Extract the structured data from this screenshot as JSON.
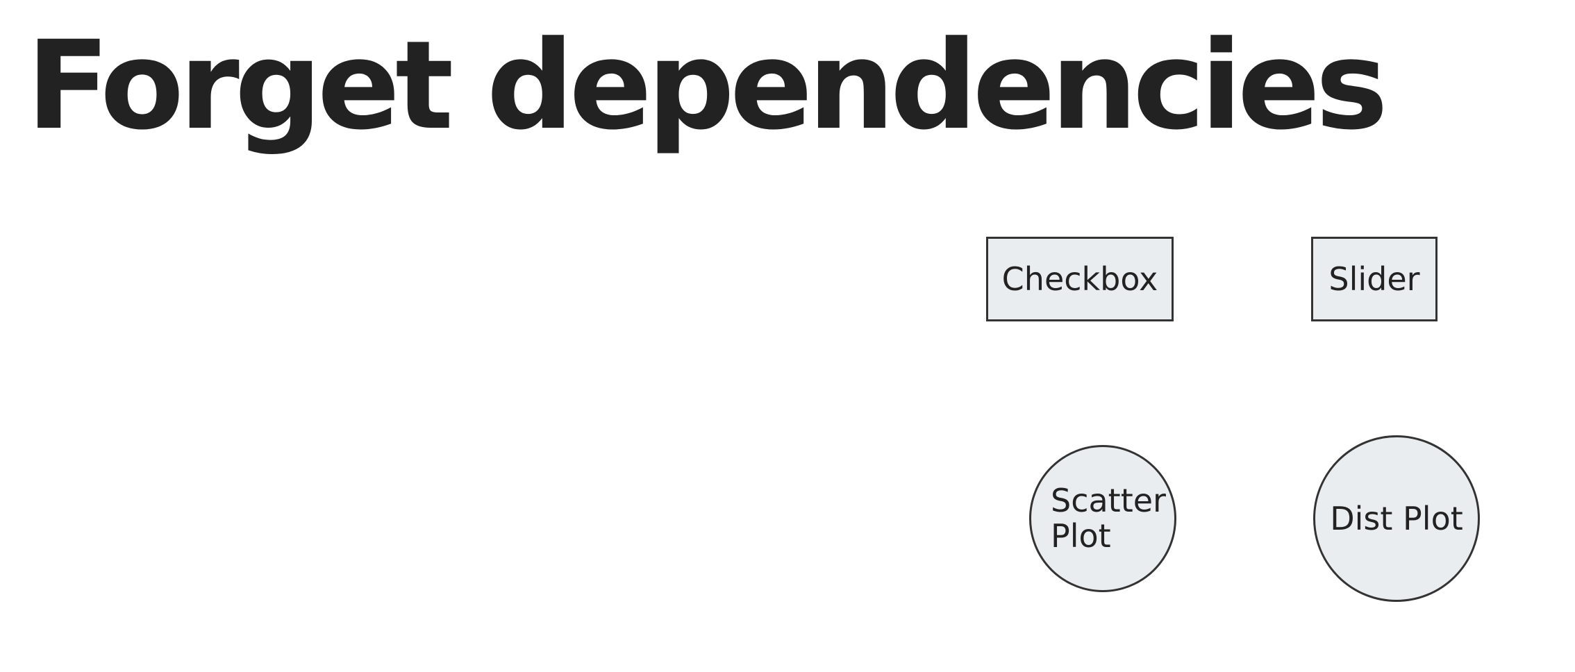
{
  "title": "Forget dependencies",
  "nodes": {
    "checkbox": "Checkbox",
    "slider": "Slider",
    "scatter_plot": "Scatter Plot",
    "dist_plot": "Dist Plot"
  },
  "colors": {
    "node_fill": "#e9edf0",
    "node_border": "#333333",
    "text": "#222222",
    "background": "#ffffff"
  }
}
